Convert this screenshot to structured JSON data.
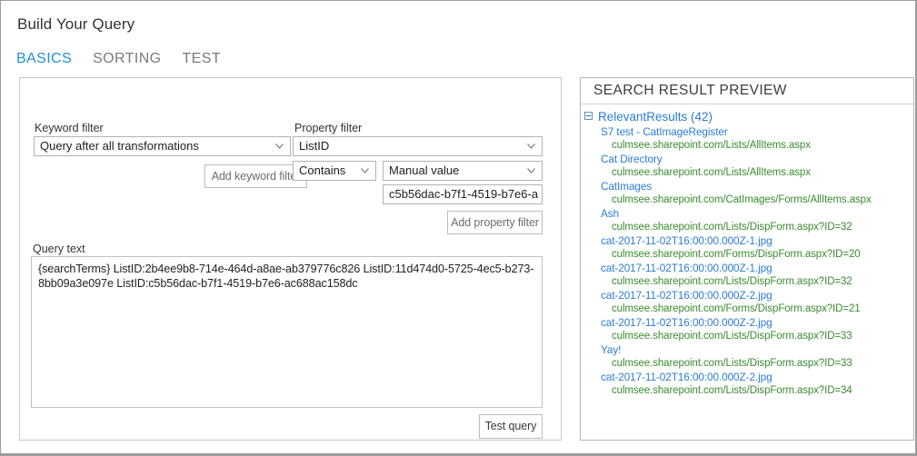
{
  "page": {
    "title": "Build Your Query"
  },
  "tabs": [
    {
      "label": "BASICS",
      "active": true
    },
    {
      "label": "SORTING",
      "active": false
    },
    {
      "label": "TEST",
      "active": false
    }
  ],
  "basics": {
    "keyword_filter": {
      "label": "Keyword filter",
      "select_value": "Query after all transformations",
      "add_button": "Add keyword filter"
    },
    "property_filter": {
      "label": "Property filter",
      "property_value": "ListID",
      "operator_value": "Contains",
      "value_mode": "Manual value",
      "manual_value": "c5b56dac-b7f1-4519-b7e6-a",
      "manual_value_placeholder": "",
      "add_button": "Add property filter"
    },
    "query_text": {
      "label": "Query text",
      "value": "{searchTerms}    ListID:2b4ee9b8-714e-464d-a8ae-ab379776c826 ListID:11d474d0-5725-4ec5-b273-8bb09a3e097e  ListID:c5b56dac-b7f1-4519-b7e6-ac688ac158dc"
    },
    "test_query_button": "Test query"
  },
  "preview": {
    "header": "SEARCH RESULT PREVIEW",
    "group_label": "RelevantResults (42)",
    "toggle_icon": "collapse-minus-icon",
    "items": [
      {
        "title": "S7 test - CatImageRegister",
        "url": "culmsee.sharepoint.com/Lists/AllItems.aspx"
      },
      {
        "title": "Cat Directory",
        "url": "culmsee.sharepoint.com/Lists/AllItems.aspx"
      },
      {
        "title": "CatImages",
        "url": "culmsee.sharepoint.com/CatImages/Forms/AllItems.aspx"
      },
      {
        "title": "Ash",
        "url": "culmsee.sharepoint.com/Lists/DispForm.aspx?ID=32"
      },
      {
        "title": "cat-2017-11-02T16:00:00.000Z-1.jpg",
        "url": "culmsee.sharepoint.com/Forms/DispForm.aspx?ID=20"
      },
      {
        "title": "cat-2017-11-02T16:00:00.000Z-1.jpg",
        "url": "culmsee.sharepoint.com/Lists/DispForm.aspx?ID=32"
      },
      {
        "title": "cat-2017-11-02T16:00:00.000Z-2.jpg",
        "url": "culmsee.sharepoint.com/Forms/DispForm.aspx?ID=21"
      },
      {
        "title": "cat-2017-11-02T16:00:00.000Z-2.jpg",
        "url": "culmsee.sharepoint.com/Lists/DispForm.aspx?ID=33"
      },
      {
        "title": "Yay!",
        "url": "culmsee.sharepoint.com/Lists/DispForm.aspx?ID=33"
      },
      {
        "title": "cat-2017-11-02T16:00:00.000Z-2.jpg",
        "url": "culmsee.sharepoint.com/Lists/DispForm.aspx?ID=34"
      }
    ]
  },
  "colors": {
    "accent": "#1e90d8",
    "link": "#2b7cd3",
    "url": "#3a8c2f",
    "muted": "#7a7a7a"
  }
}
